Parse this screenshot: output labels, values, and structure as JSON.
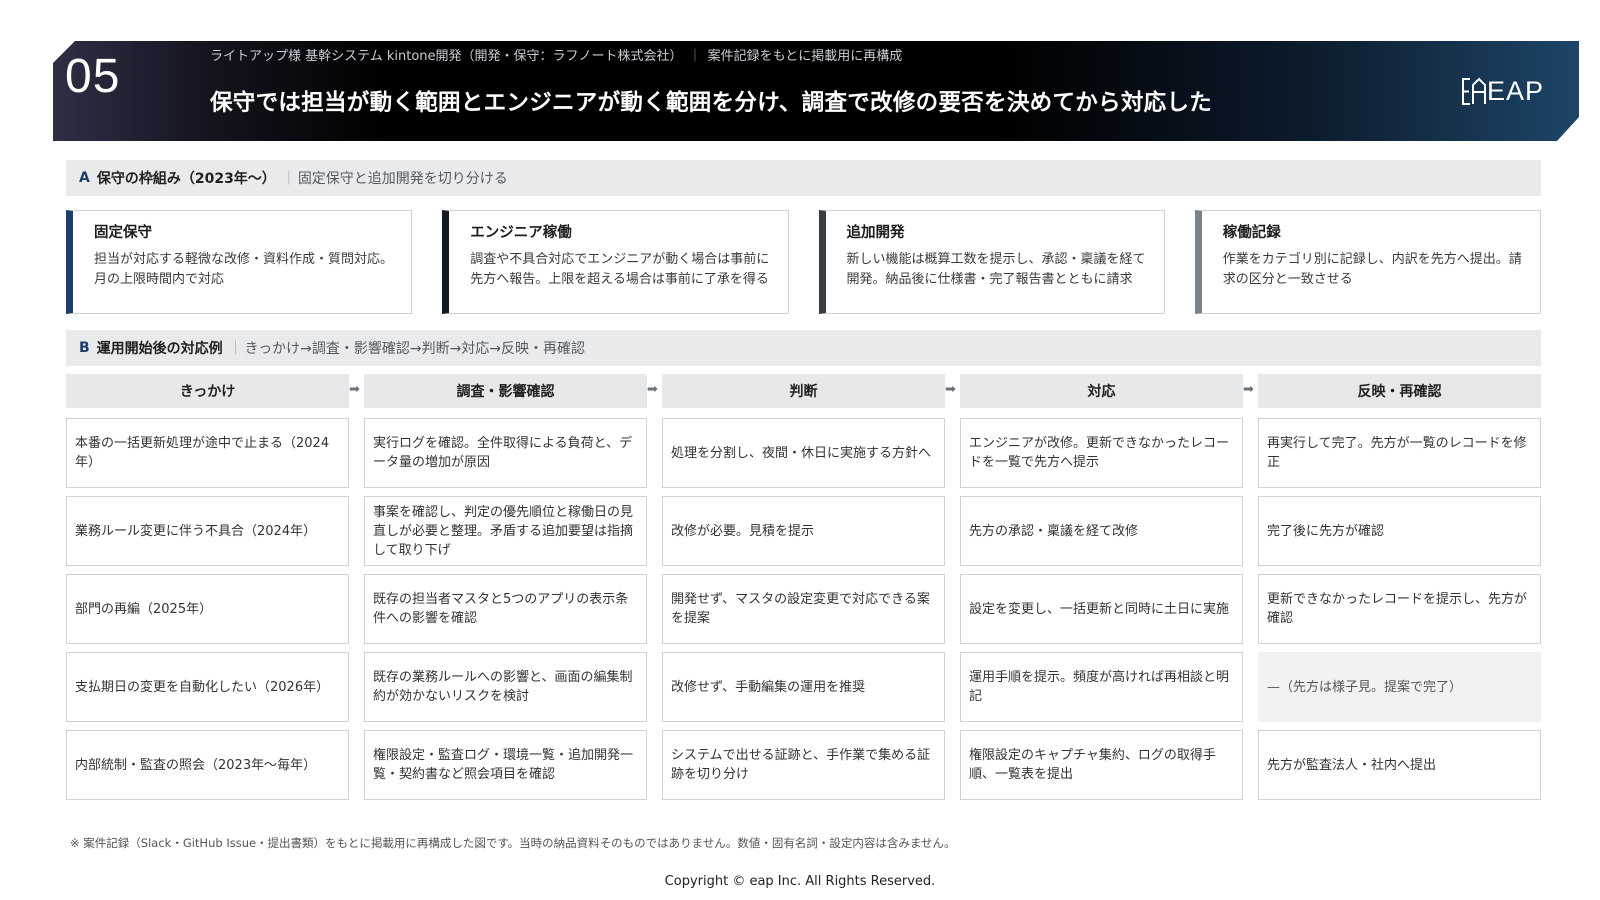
{
  "header": {
    "number": "05",
    "subtitle": "ライトアップ様 基幹システム kintone開発（開発・保守：ラフノート株式会社）",
    "subtitle_note": "案件記録をもとに掲載用に再構成",
    "title": "保守では担当が動く範囲とエンジニアが動く範囲を分け、調査で改修の要否を決めてから対応した",
    "logo_text": "EAP"
  },
  "section_a": {
    "letter": "A",
    "title": "保守の枠組み（2023年〜）",
    "desc": "固定保守と追加開発を切り分ける",
    "cards": [
      {
        "title": "固定保守",
        "body": "担当が対応する軽微な改修・資料作成・質問対応。月の上限時間内で対応",
        "accent": "#1e3d6b"
      },
      {
        "title": "エンジニア稼働",
        "body": "調査や不具合対応でエンジニアが動く場合は事前に先方へ報告。上限を超える場合は事前に了承を得る",
        "accent": "#141a26"
      },
      {
        "title": "追加開発",
        "body": "新しい機能は概算工数を提示し、承認・稟議を経て開発。納品後に仕様書・完了報告書とともに請求",
        "accent": "#3a3d44"
      },
      {
        "title": "稼働記録",
        "body": "作業をカテゴリ別に記録し、内訳を先方へ提出。請求の区分と一致させる",
        "accent": "#7c828c"
      }
    ]
  },
  "section_b": {
    "letter": "B",
    "title": "運用開始後の対応例",
    "desc": "きっかけ→調査・影響確認→判断→対応→反映・再確認",
    "columns": [
      "きっかけ",
      "調査・影響確認",
      "判断",
      "対応",
      "反映・再確認"
    ],
    "rows": [
      [
        "本番の一括更新処理が途中で止まる（2024年）",
        "実行ログを確認。全件取得による負荷と、データ量の増加が原因",
        "処理を分割し、夜間・休日に実施する方針へ",
        "エンジニアが改修。更新できなかったレコードを一覧で先方へ提示",
        "再実行して完了。先方が一覧のレコードを修正"
      ],
      [
        "業務ルール変更に伴う不具合（2024年）",
        "事案を確認し、判定の優先順位と稼働日の見直しが必要と整理。矛盾する追加要望は指摘して取り下げ",
        "改修が必要。見積を提示",
        "先方の承認・稟議を経て改修",
        "完了後に先方が確認"
      ],
      [
        "部門の再編（2025年）",
        "既存の担当者マスタと5つのアプリの表示条件への影響を確認",
        "開発せず、マスタの設定変更で対応できる案を提案",
        "設定を変更し、一括更新と同時に土日に実施",
        "更新できなかったレコードを提示し、先方が確認"
      ],
      [
        "支払期日の変更を自動化したい（2026年）",
        "既存の業務ルールへの影響と、画面の編集制約が効かないリスクを検討",
        "改修せず、手動編集の運用を推奨",
        "運用手順を提示。頻度が高ければ再相談と明記",
        "—（先方は様子見。提案で完了）"
      ],
      [
        "内部統制・監査の照会（2023年〜毎年）",
        "権限設定・監査ログ・環境一覧・追加開発一覧・契約書など照会項目を確認",
        "システムで出せる証跡と、手作業で集める証跡を切り分け",
        "権限設定のキャプチャ集約、ログの取得手順、一覧表を提出",
        "先方が監査法人・社内へ提出"
      ]
    ]
  },
  "footnote": "※ 案件記録（Slack・GitHub Issue・提出書類）をもとに掲載用に再構成した図です。当時の納品資料そのものではありません。数値・固有名詞・設定内容は含みません。",
  "copyright": "Copyright © eap Inc. All Rights Reserved."
}
